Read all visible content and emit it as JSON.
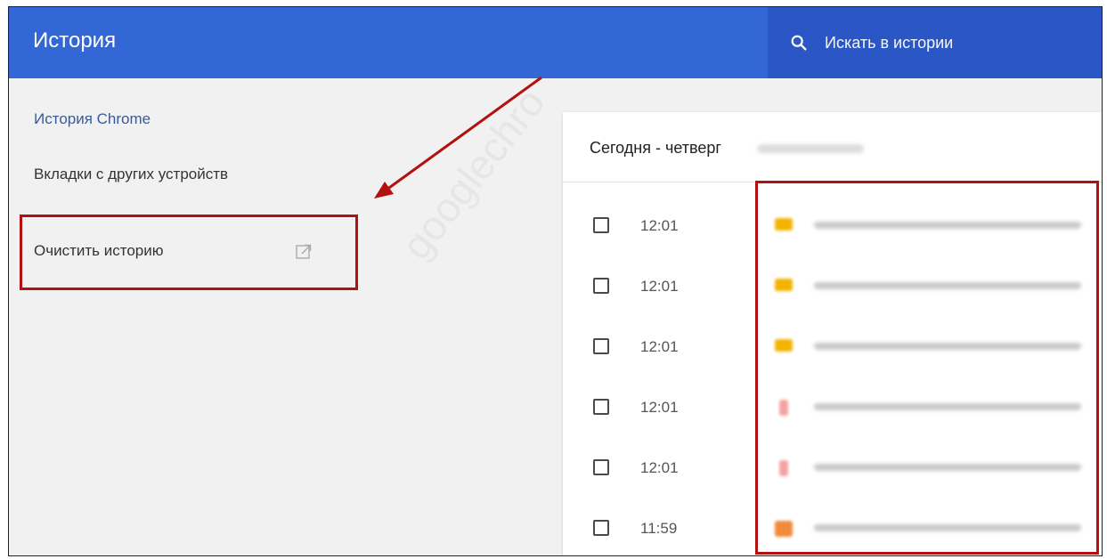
{
  "header": {
    "title": "История",
    "search_placeholder": "Искать в истории",
    "search_icon": "search-icon"
  },
  "sidebar": {
    "items": [
      {
        "label": "История Chrome",
        "active": true
      },
      {
        "label": "Вкладки с других устройств"
      },
      {
        "label": "Очистить историю",
        "icon": "open-in-new-icon"
      }
    ]
  },
  "history": {
    "date_label": "Сегодня - четверг",
    "rows": [
      {
        "time": "12:01",
        "favicon_color": "#f2b400"
      },
      {
        "time": "12:01",
        "favicon_color": "#f2b400"
      },
      {
        "time": "12:01",
        "favicon_color": "#f2b400"
      },
      {
        "time": "12:01",
        "favicon_color": "#f4a3a3"
      },
      {
        "time": "12:01",
        "favicon_color": "#f4a3a3"
      },
      {
        "time": "11:59",
        "favicon_color": "#f08a3c"
      }
    ]
  },
  "annotations": {
    "highlight_color": "#b31010",
    "watermark": "googlechro"
  },
  "colors": {
    "topbar": "#3367d6",
    "search_bg": "#2a56c6",
    "link": "#3a5a99"
  }
}
